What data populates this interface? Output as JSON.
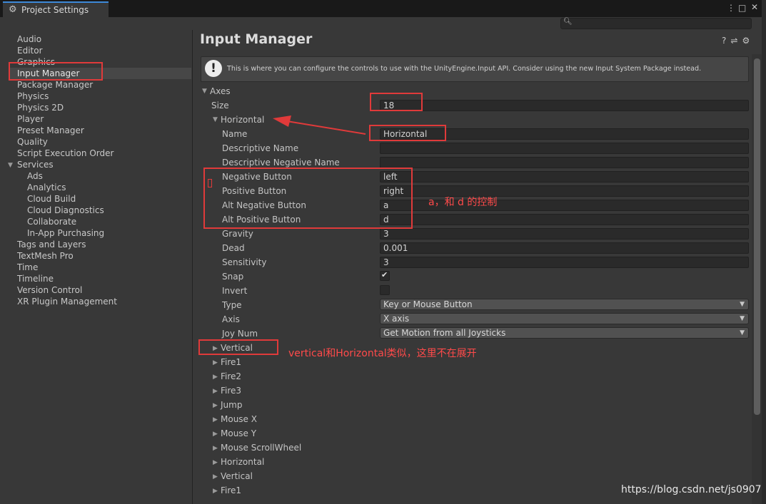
{
  "window": {
    "tab_title": "Project Settings",
    "search_placeholder": ""
  },
  "sidebar": {
    "items": [
      {
        "label": "Audio",
        "level": 0
      },
      {
        "label": "Editor",
        "level": 0
      },
      {
        "label": "Graphics",
        "level": 0
      },
      {
        "label": "Input Manager",
        "level": 0,
        "selected": true
      },
      {
        "label": "Package Manager",
        "level": 0
      },
      {
        "label": "Physics",
        "level": 0
      },
      {
        "label": "Physics 2D",
        "level": 0
      },
      {
        "label": "Player",
        "level": 0
      },
      {
        "label": "Preset Manager",
        "level": 0
      },
      {
        "label": "Quality",
        "level": 0
      },
      {
        "label": "Script Execution Order",
        "level": 0
      },
      {
        "label": "Services",
        "level": 0,
        "expanded": true
      },
      {
        "label": "Ads",
        "level": 1
      },
      {
        "label": "Analytics",
        "level": 1
      },
      {
        "label": "Cloud Build",
        "level": 1
      },
      {
        "label": "Cloud Diagnostics",
        "level": 1
      },
      {
        "label": "Collaborate",
        "level": 1
      },
      {
        "label": "In-App Purchasing",
        "level": 1
      },
      {
        "label": "Tags and Layers",
        "level": 0
      },
      {
        "label": "TextMesh Pro",
        "level": 0
      },
      {
        "label": "Time",
        "level": 0
      },
      {
        "label": "Timeline",
        "level": 0
      },
      {
        "label": "Version Control",
        "level": 0
      },
      {
        "label": "XR Plugin Management",
        "level": 0
      }
    ]
  },
  "main": {
    "title": "Input Manager",
    "info_text": "This is where you can configure the controls to use with the UnityEngine.Input API. Consider using the new Input System Package instead.",
    "axes_label": "Axes",
    "size_label": "Size",
    "size_value": "18",
    "horizontal": {
      "header": "Horizontal",
      "name_label": "Name",
      "name_value": "Horizontal",
      "descriptive_name_label": "Descriptive Name",
      "descriptive_name_value": "",
      "descriptive_negative_name_label": "Descriptive Negative Name",
      "descriptive_negative_name_value": "",
      "negative_button_label": "Negative Button",
      "negative_button_value": "left",
      "positive_button_label": "Positive Button",
      "positive_button_value": "right",
      "alt_negative_button_label": "Alt Negative Button",
      "alt_negative_button_value": "a",
      "alt_positive_button_label": "Alt Positive Button",
      "alt_positive_button_value": "d",
      "gravity_label": "Gravity",
      "gravity_value": "3",
      "dead_label": "Dead",
      "dead_value": "0.001",
      "sensitivity_label": "Sensitivity",
      "sensitivity_value": "3",
      "snap_label": "Snap",
      "snap_checked": true,
      "invert_label": "Invert",
      "invert_checked": false,
      "type_label": "Type",
      "type_value": "Key or Mouse Button",
      "axis_label": "Axis",
      "axis_value": "X axis",
      "joy_num_label": "Joy Num",
      "joy_num_value": "Get Motion from all Joysticks"
    },
    "collapsed_axes": [
      "Vertical",
      "Fire1",
      "Fire2",
      "Fire3",
      "Jump",
      "Mouse X",
      "Mouse Y",
      "Mouse ScrollWheel",
      "Horizontal",
      "Vertical",
      "Fire1"
    ]
  },
  "annotations": {
    "ad_control_note": "a，和 d 的控制",
    "vertical_note": "vertical和Horizontal类似，这里不在展开",
    "annotation_color": "#e03a3a"
  },
  "watermark": "https://blog.csdn.net/js0907"
}
